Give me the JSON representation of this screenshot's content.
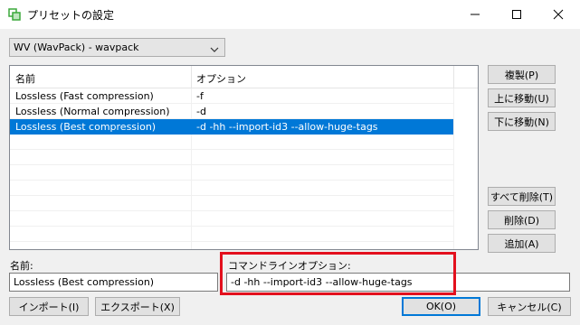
{
  "window": {
    "title": "プリセットの設定",
    "icon": "preset-app-icon",
    "controls": [
      "minimize-icon",
      "maximize-icon",
      "close-icon"
    ]
  },
  "preset_select": {
    "value": "WV (WavPack) - wavpack"
  },
  "list": {
    "columns": [
      "名前",
      "オプション"
    ],
    "rows": [
      {
        "name": "Lossless (Fast compression)",
        "option": "-f",
        "selected": false
      },
      {
        "name": "Lossless (Normal compression)",
        "option": "-d",
        "selected": false
      },
      {
        "name": "Lossless (Best compression)",
        "option": "-d -hh --import-id3 --allow-huge-tags",
        "selected": true
      }
    ]
  },
  "side_buttons": {
    "duplicate": "複製(P)",
    "move_up": "上に移動(U)",
    "move_down": "下に移動(N)",
    "delete_all": "すべて削除(T)",
    "delete": "削除(D)",
    "add": "追加(A)"
  },
  "fields": {
    "name_label": "名前:",
    "name_value": "Lossless (Best compression)",
    "options_label": "コマンドラインオプション:",
    "options_value": "-d -hh --import-id3 --allow-huge-tags"
  },
  "footer_buttons": {
    "import": "インポート(I)",
    "export": "エクスポート(X)",
    "ok": "OK(O)",
    "cancel": "キャンセル(C)"
  },
  "colors": {
    "selection": "#0078d7",
    "highlight_box": "#e3101d",
    "app_icon": "#3aa83a"
  }
}
